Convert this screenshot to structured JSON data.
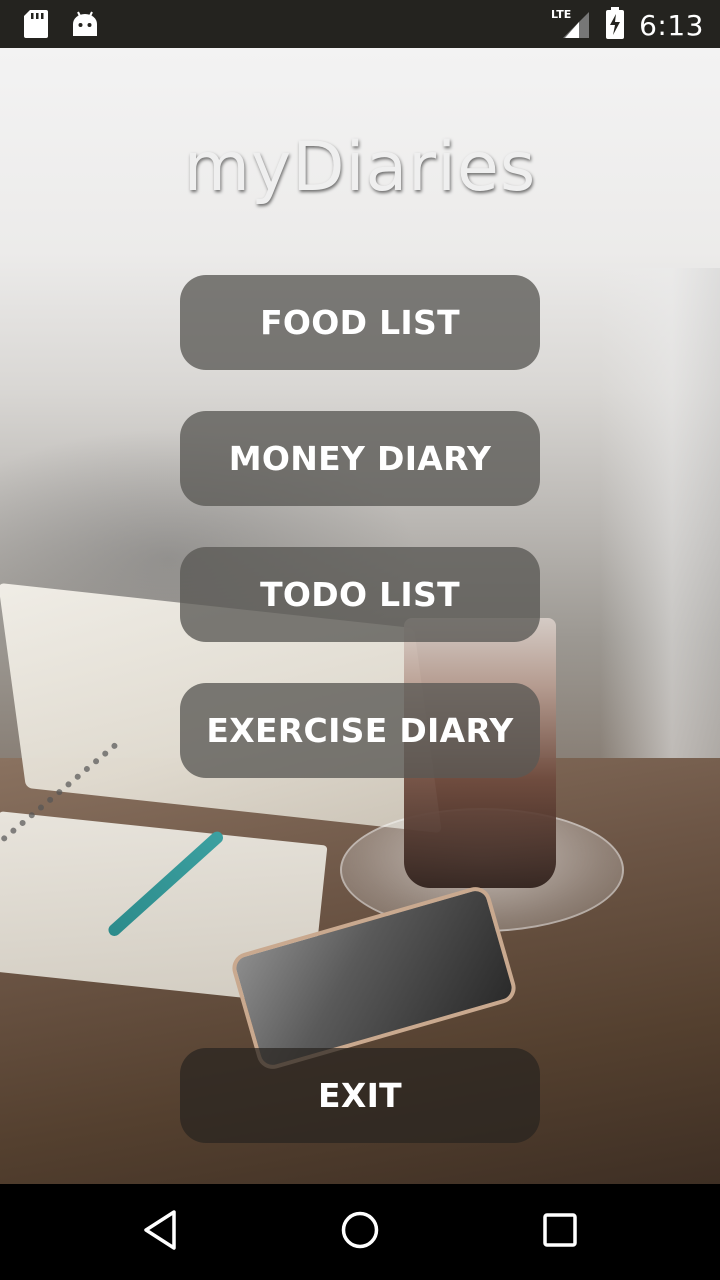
{
  "status_bar": {
    "time": "6:13",
    "network": "LTE"
  },
  "app": {
    "title": "myDiaries"
  },
  "menu": {
    "food_list": "FOOD LIST",
    "money_diary": "MONEY DIARY",
    "todo_list": "TODO LIST",
    "exercise_diary": "EXERCISE DIARY",
    "exit": "EXIT"
  },
  "colors": {
    "button_bg": "#5a5854",
    "status_bar_bg": "#24231f",
    "nav_bar_bg": "#000000"
  },
  "icons": {
    "status_left": [
      "sd-card-icon",
      "android-icon"
    ],
    "status_right": [
      "lte-signal-icon",
      "battery-charging-icon"
    ],
    "nav": [
      "back-icon",
      "home-icon",
      "recents-icon"
    ]
  }
}
